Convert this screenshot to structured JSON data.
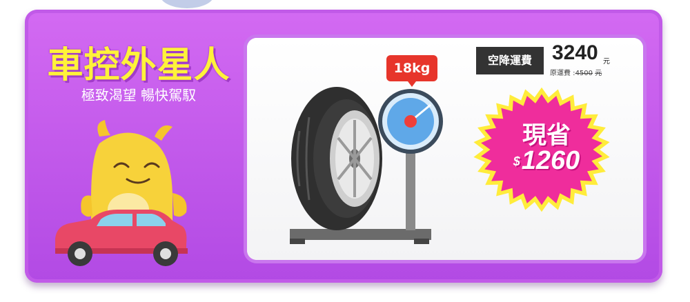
{
  "brand": {
    "title": "車控外星人",
    "subtitle": "極致渴望 暢快駕馭"
  },
  "weight": {
    "label": "18kg"
  },
  "shipping": {
    "badge": "空降運費",
    "price": "3240",
    "unit": "元",
    "original_prefix": "原運費 :",
    "original_price": "4500",
    "original_unit": "元"
  },
  "savings": {
    "label": "現省",
    "currency": "$",
    "amount": "1260"
  },
  "colors": {
    "banner": "#b24ae4",
    "title": "#fff23a",
    "burst_fill": "#ef2d9c",
    "burst_outline": "#ffec3b",
    "tag": "#e7352b",
    "car": "#e84866",
    "mascot": "#f7d23a"
  },
  "icons": {
    "mascot": "alien-mascot-icon",
    "car": "car-icon",
    "tire": "tire-icon",
    "scale": "scale-icon"
  }
}
